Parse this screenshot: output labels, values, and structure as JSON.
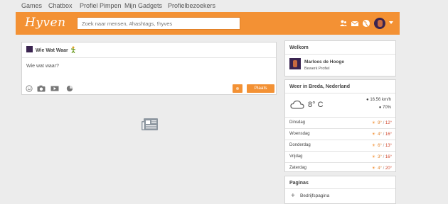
{
  "topnav": {
    "items": [
      "Games",
      "Chatbox",
      "Profiel Pimpen",
      "Mijn Gadgets",
      "Profielbezoekers"
    ]
  },
  "header": {
    "logo": "Hyven",
    "search_placeholder": "Zoek naar mensen, #hashtags, !hyves",
    "icons": [
      "friends-icon",
      "mail-icon",
      "globe-icon",
      "avatar",
      "chevron-down-icon"
    ],
    "accent": "#f39134"
  },
  "composer": {
    "title": "Wie Wat Waar",
    "prompt": "Wie wat waar?",
    "post_label": "Plaats",
    "tools": [
      "smiley-icon",
      "camera-icon",
      "video-icon",
      "pie-icon"
    ]
  },
  "welkom": {
    "title": "Welkom",
    "name": "Marloes de Hooge",
    "edit_label": "Bewerk Profiel"
  },
  "weer": {
    "title": "Weer in Breda, Nederland",
    "temperature": "8° C",
    "wind": "16.56 km/h",
    "humidity": "70%",
    "forecast": [
      {
        "day": "Dinsdag",
        "low": "9°",
        "high": "12°"
      },
      {
        "day": "Woensdag",
        "low": "4°",
        "high": "16°"
      },
      {
        "day": "Donderdag",
        "low": "6°",
        "high": "13°"
      },
      {
        "day": "Vrijdag",
        "low": "3°",
        "high": "16°"
      },
      {
        "day": "Zaterdag",
        "low": "4°",
        "high": "20°"
      }
    ]
  },
  "paginas": {
    "title": "Paginas",
    "link": "Bedrijfspagina"
  }
}
